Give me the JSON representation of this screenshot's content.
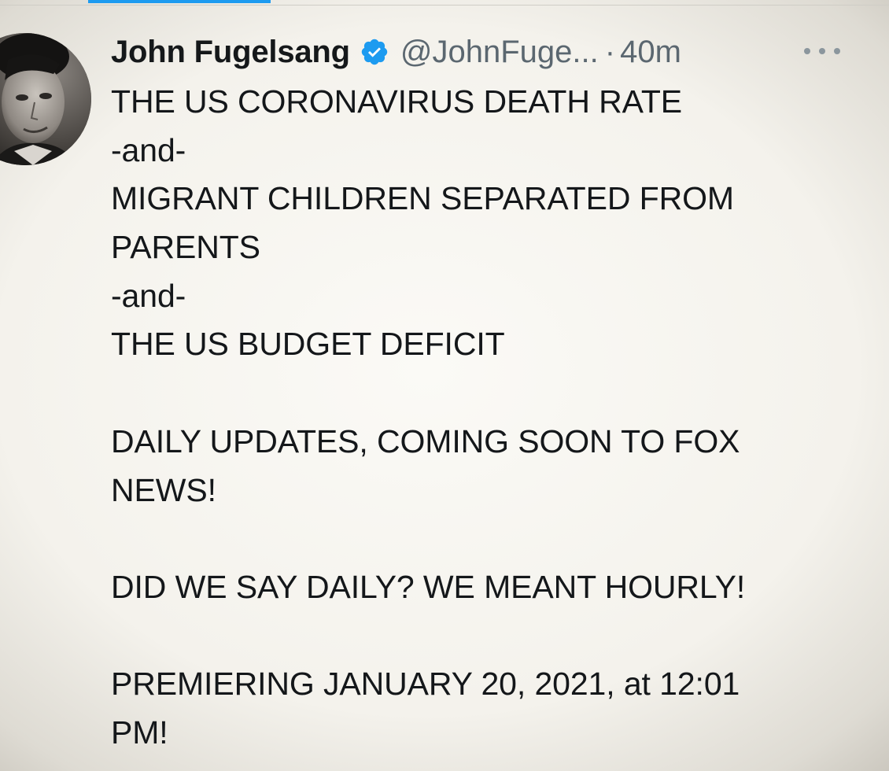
{
  "top_tab": {
    "active_color": "#1d9bf0"
  },
  "tweet": {
    "author": {
      "display_name": "John Fugelsang",
      "handle": "@JohnFuge...",
      "verified": true,
      "verified_icon": "verified-badge-icon",
      "verified_color": "#1d9bf0",
      "avatar_icon": "profile-photo"
    },
    "separator": "·",
    "time": "40m",
    "more_icon": "more-options-icon",
    "body_lines": {
      "l1": "THE US CORONAVIRUS DEATH RATE",
      "l2": "-and-",
      "l3": "MIGRANT CHILDREN SEPARATED FROM",
      "l4": "PARENTS",
      "l5": "-and-",
      "l6": "THE US BUDGET DEFICIT",
      "l7": "DAILY UPDATES, COMING SOON TO FOX",
      "l8": "NEWS!",
      "l9": "DID WE SAY DAILY? WE MEANT HOURLY!",
      "l10": "PREMIERING JANUARY 20, 2021, at 12:01",
      "l11": "PM!"
    }
  }
}
